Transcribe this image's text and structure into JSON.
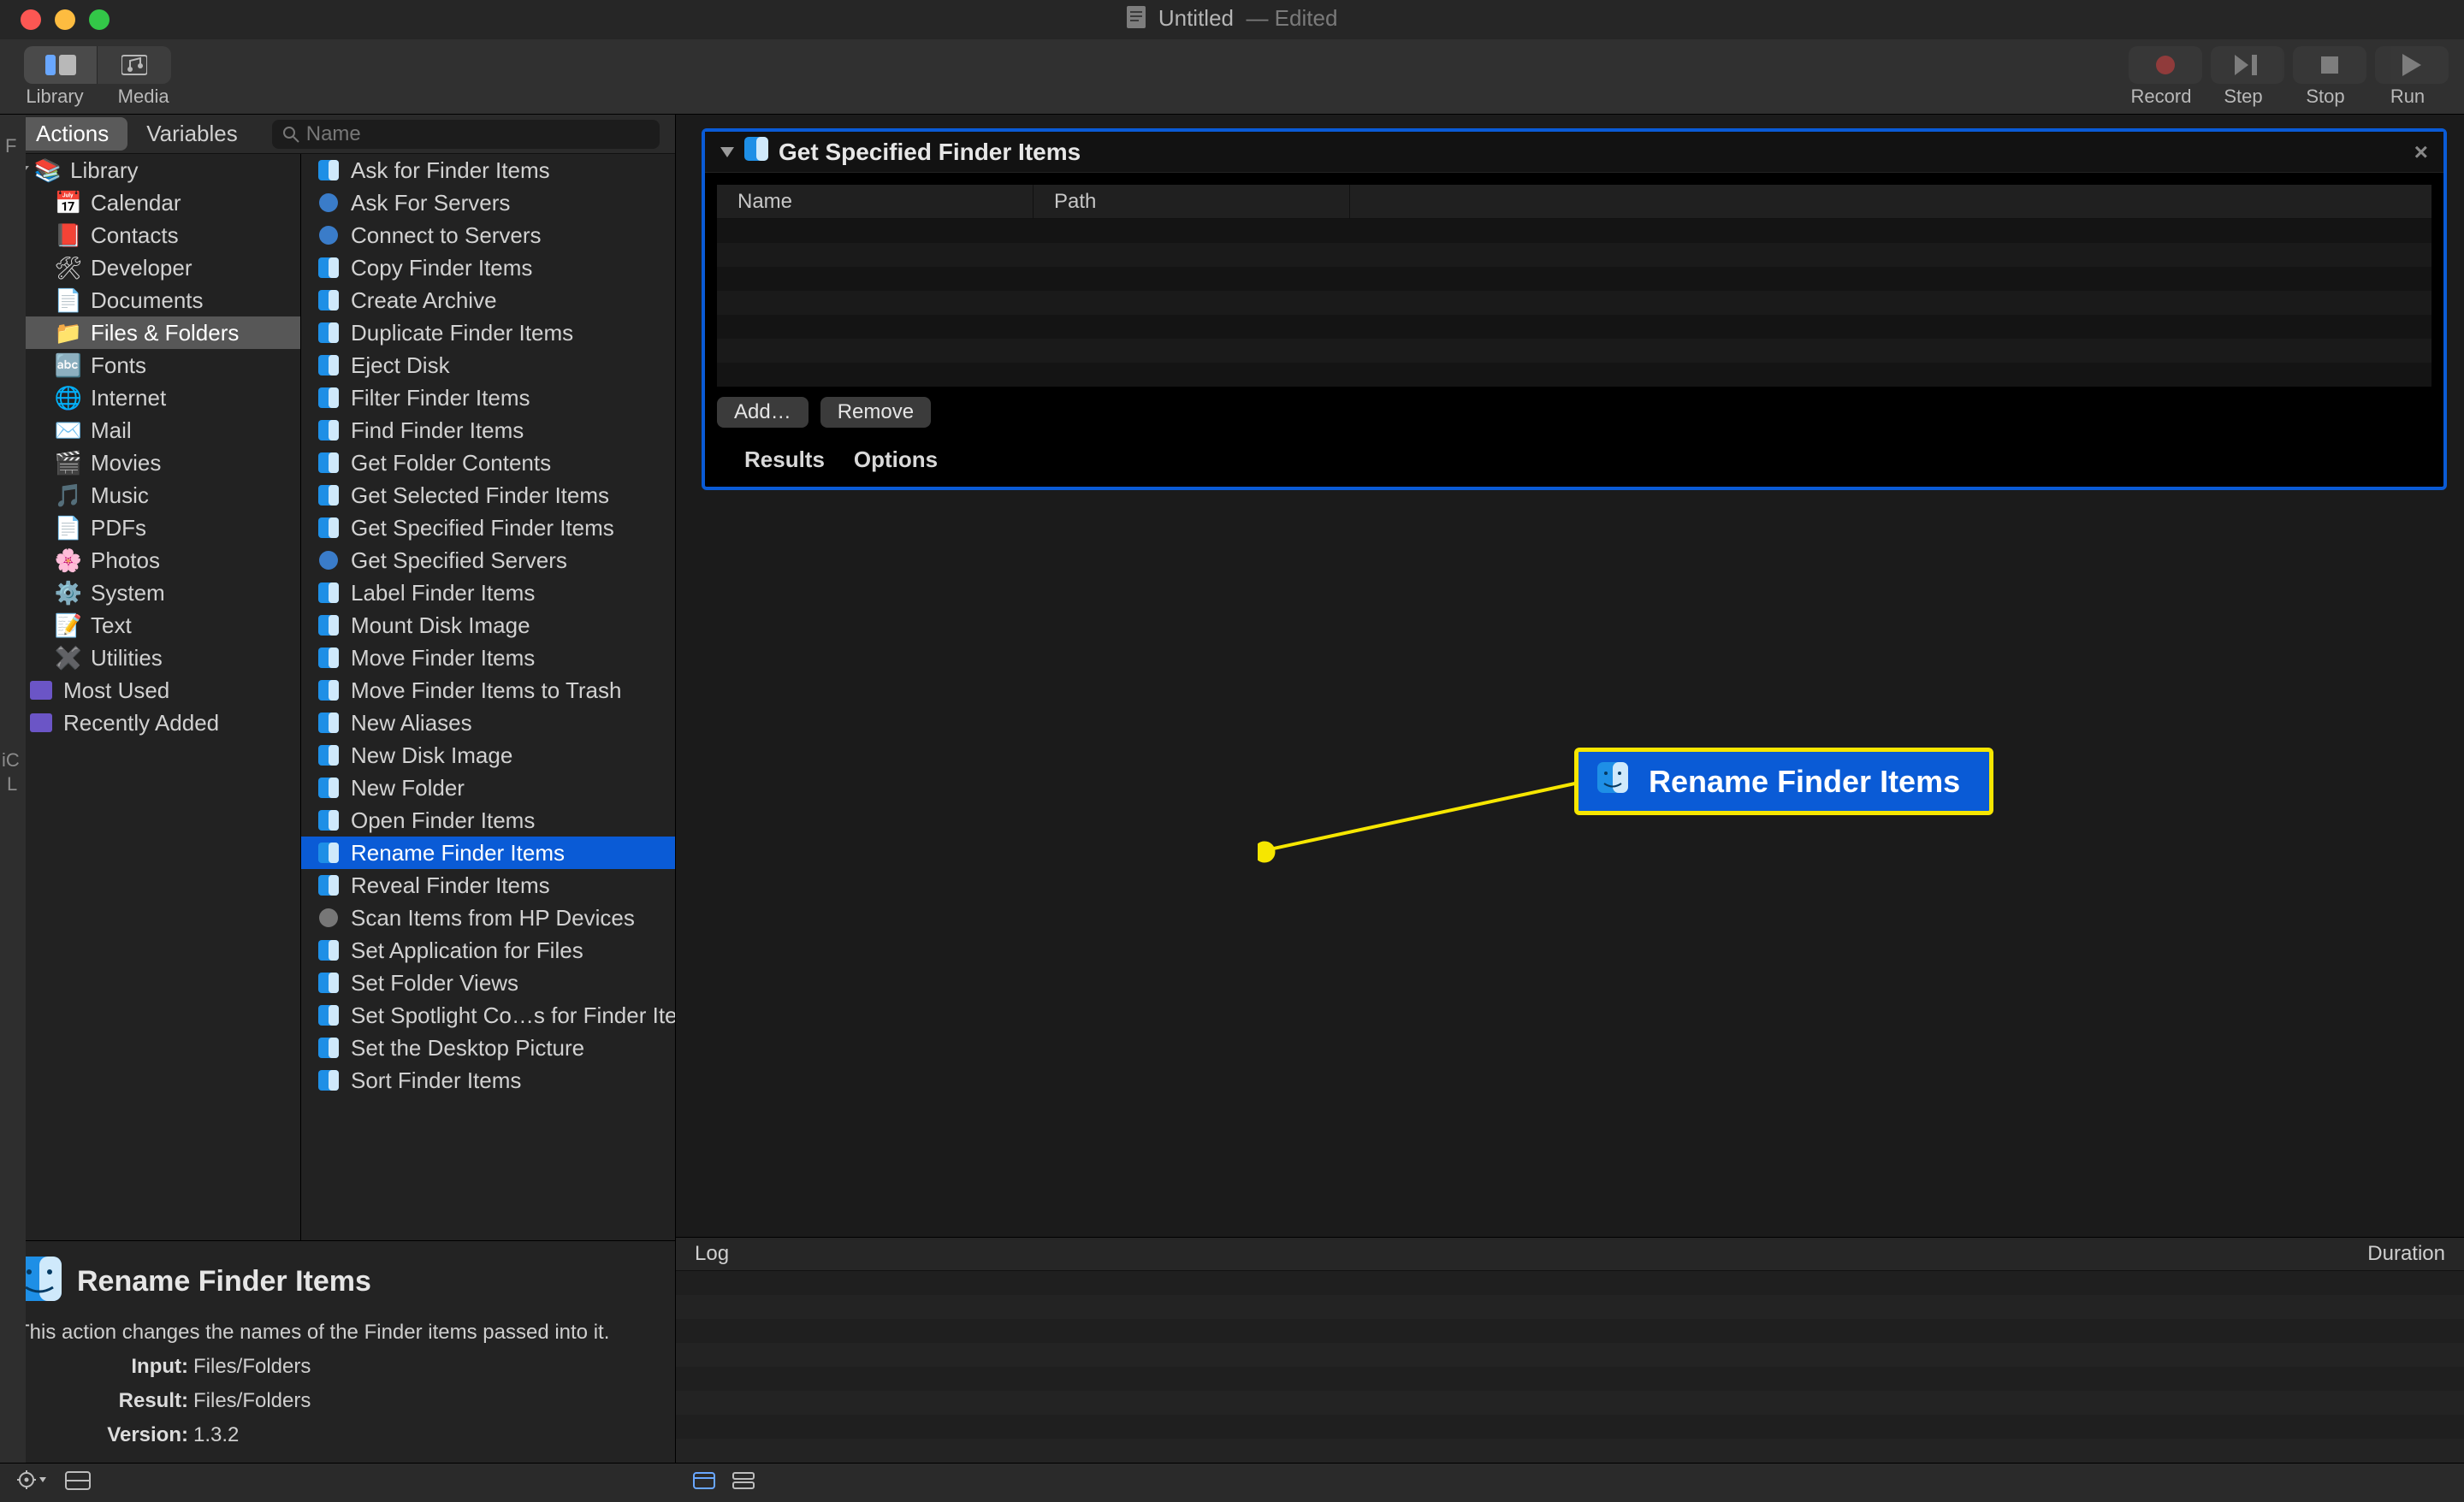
{
  "window": {
    "title": "Untitled",
    "edited": "— Edited"
  },
  "traffic": {
    "close": "#fc5753",
    "min": "#fdbc40",
    "max": "#33c748"
  },
  "toolbar": {
    "library_label": "Library",
    "media_label": "Media",
    "record_label": "Record",
    "step_label": "Step",
    "stop_label": "Stop",
    "run_label": "Run"
  },
  "tabs": {
    "actions": "Actions",
    "variables": "Variables"
  },
  "search": {
    "placeholder": "Name"
  },
  "library": {
    "root": "Library",
    "categories": [
      "Calendar",
      "Contacts",
      "Developer",
      "Documents",
      "Files & Folders",
      "Fonts",
      "Internet",
      "Mail",
      "Movies",
      "Music",
      "PDFs",
      "Photos",
      "System",
      "Text",
      "Utilities"
    ],
    "selected_category_index": 4,
    "smart": [
      "Most Used",
      "Recently Added"
    ]
  },
  "actions": {
    "items": [
      "Ask for Finder Items",
      "Ask For Servers",
      "Connect to Servers",
      "Copy Finder Items",
      "Create Archive",
      "Duplicate Finder Items",
      "Eject Disk",
      "Filter Finder Items",
      "Find Finder Items",
      "Get Folder Contents",
      "Get Selected Finder Items",
      "Get Specified Finder Items",
      "Get Specified Servers",
      "Label Finder Items",
      "Mount Disk Image",
      "Move Finder Items",
      "Move Finder Items to Trash",
      "New Aliases",
      "New Disk Image",
      "New Folder",
      "Open Finder Items",
      "Rename Finder Items",
      "Reveal Finder Items",
      "Scan Items from HP Devices",
      "Set Application for Files",
      "Set Folder Views",
      "Set Spotlight Co…s for Finder Items",
      "Set the Desktop Picture",
      "Sort Finder Items"
    ],
    "selected_index": 21
  },
  "info": {
    "title": "Rename Finder Items",
    "desc": "This action changes the names of the Finder items passed into it.",
    "input_label": "Input:",
    "input_value": "Files/Folders",
    "result_label": "Result:",
    "result_value": "Files/Folders",
    "version_label": "Version:",
    "version_value": "1.3.2"
  },
  "workflow": {
    "action_title": "Get Specified Finder Items",
    "table": {
      "name_col": "Name",
      "path_col": "Path"
    },
    "add_btn": "Add…",
    "remove_btn": "Remove",
    "results_tab": "Results",
    "options_tab": "Options"
  },
  "drag": {
    "label": "Rename Finder Items"
  },
  "log": {
    "log_label": "Log",
    "duration_label": "Duration"
  }
}
